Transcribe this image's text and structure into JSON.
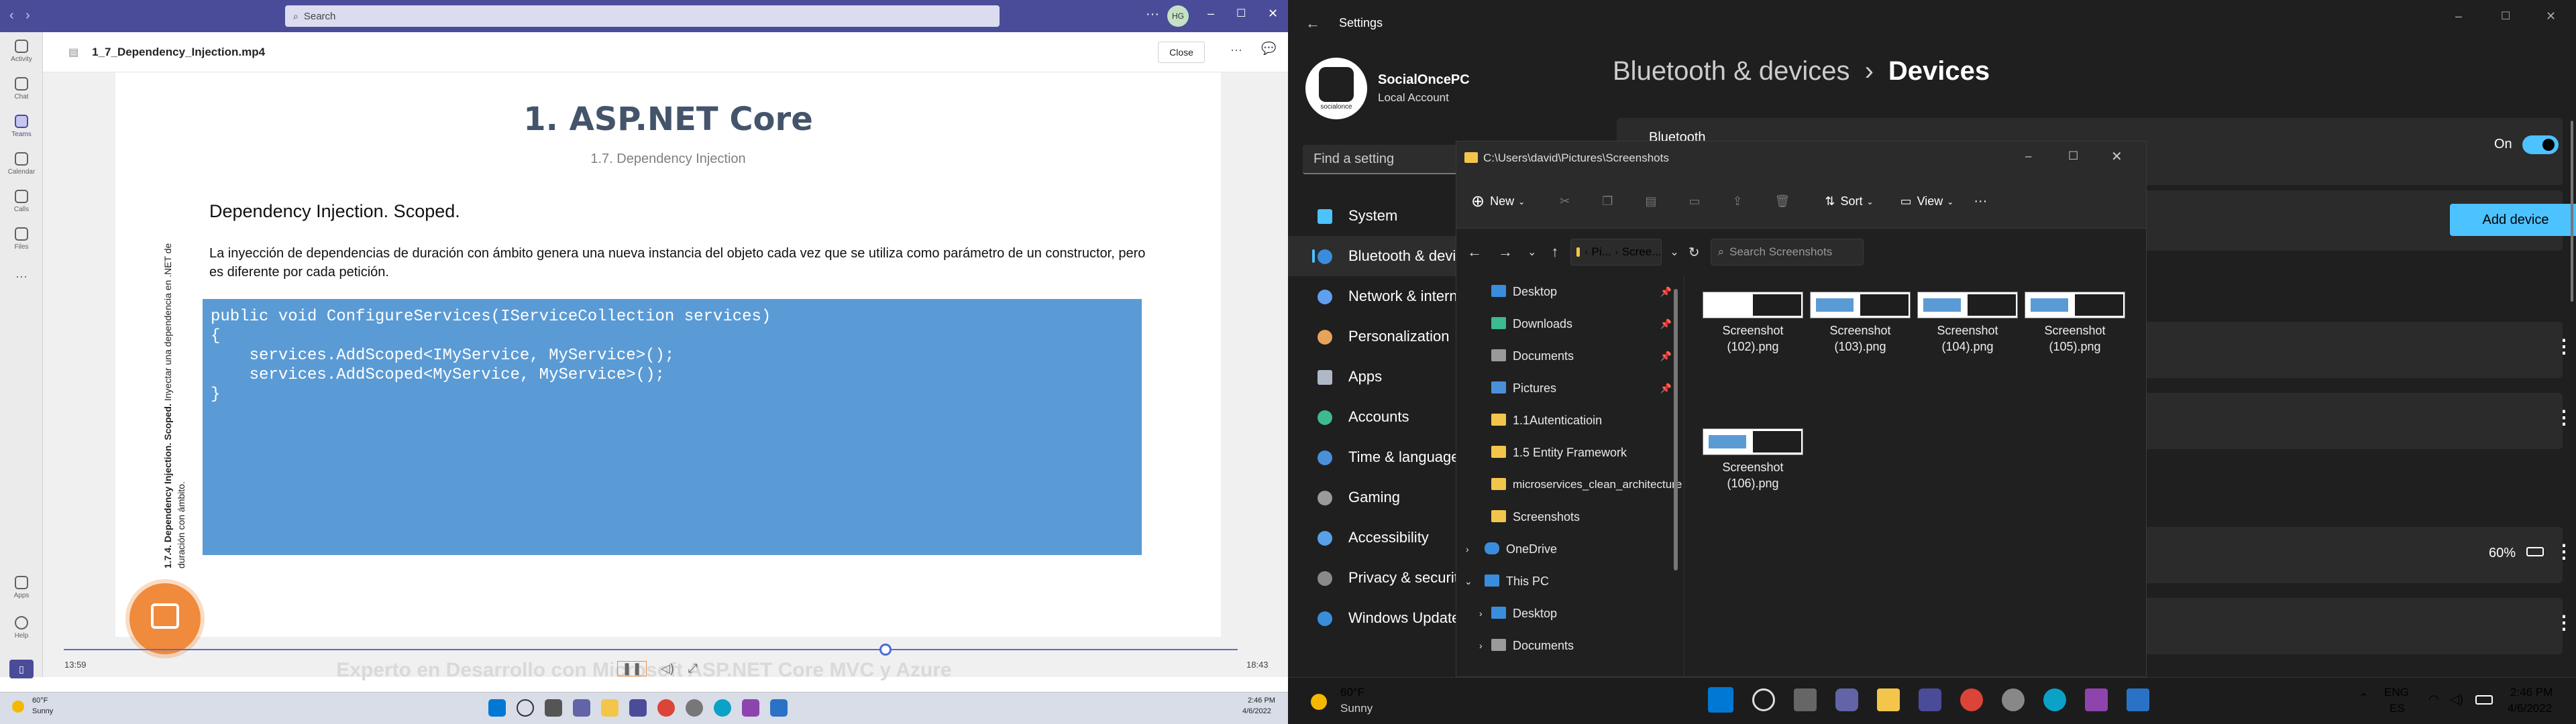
{
  "teams": {
    "search_placeholder": "Search",
    "avatar_initials": "HG",
    "rail": [
      "Activity",
      "Chat",
      "Teams",
      "Calendar",
      "Calls",
      "Files",
      "Apps",
      "Help"
    ],
    "file_title": "1_7_Dependency_Injection.mp4",
    "close_label": "Close",
    "more_label": "···",
    "time_current": "13:59",
    "time_total": "18:43",
    "footer_text": "Experto en Desarrollo con Microsoft ASP.NET Core MVC y Azure",
    "progress": 0.7,
    "taskbar_weather_temp": "60°F",
    "taskbar_weather_text": "Sunny",
    "taskbar_time": "2:46 PM",
    "taskbar_date": "4/6/2022"
  },
  "slide": {
    "title": "1. ASP.NET Core",
    "subtitle": "1.7. Dependency Injection",
    "section_heading": "Dependency Injection. Scoped.",
    "body_text": "La inyección de dependencias de duración con ámbito genera una nueva instancia del objeto cada vez que se utiliza como parámetro de un constructor, pero es diferente por cada petición.",
    "code_lines": [
      "public void ConfigureServices(IServiceCollection services)",
      "{",
      "    services.AddScoped<IMyService, MyService>();",
      "    services.AddScoped<MyService, MyService>();",
      "}"
    ],
    "vertical_bold": "1.7.4. Dependency Injection. Scoped.",
    "vertical_text": " Inyectar una dependencia en .NET de duración con ámbito."
  },
  "settings": {
    "window_title": "Settings",
    "profile_name": "SocialOncePC",
    "profile_sub": "Local Account",
    "logo_text": "socialonce",
    "find_placeholder": "Find a setting",
    "breadcrumb_parent": "Bluetooth & devices",
    "breadcrumb_sep": "›",
    "breadcrumb_current": "Devices",
    "nav": [
      "System",
      "Bluetooth & devi",
      "Network & intern",
      "Personalization",
      "Apps",
      "Accounts",
      "Time & language",
      "Gaming",
      "Accessibility",
      "Privacy & security",
      "Windows Update"
    ],
    "bluetooth_label": "Bluetooth",
    "toggle_label": "On",
    "add_device_label": "Add device",
    "battery_label": "60%",
    "accent": "#4cc2ff"
  },
  "explorer": {
    "title": "C:\\Users\\david\\Pictures\\Screenshots",
    "toolbar": {
      "new": "New",
      "sort": "Sort",
      "view": "View",
      "more": "···"
    },
    "breadcrumb": [
      "Pi...",
      "Scree..."
    ],
    "search_placeholder": "Search Screenshots",
    "nav_items": [
      "Desktop",
      "Downloads",
      "Documents",
      "Pictures",
      "1.1Autenticatioin",
      "1.5 Entity Framework",
      "microservices_clean_architecture",
      "Screenshots",
      "OneDrive",
      "This PC",
      "Desktop",
      "Documents"
    ],
    "files": [
      "Screenshot (102).png",
      "Screenshot (103).png",
      "Screenshot (104).png",
      "Screenshot (105).png",
      "Screenshot (106).png"
    ]
  },
  "taskbar": {
    "weather_temp": "60°F",
    "weather_text": "Sunny",
    "lang": "ENG",
    "region": "ES",
    "time": "2:46 PM",
    "date": "4/6/2022"
  }
}
